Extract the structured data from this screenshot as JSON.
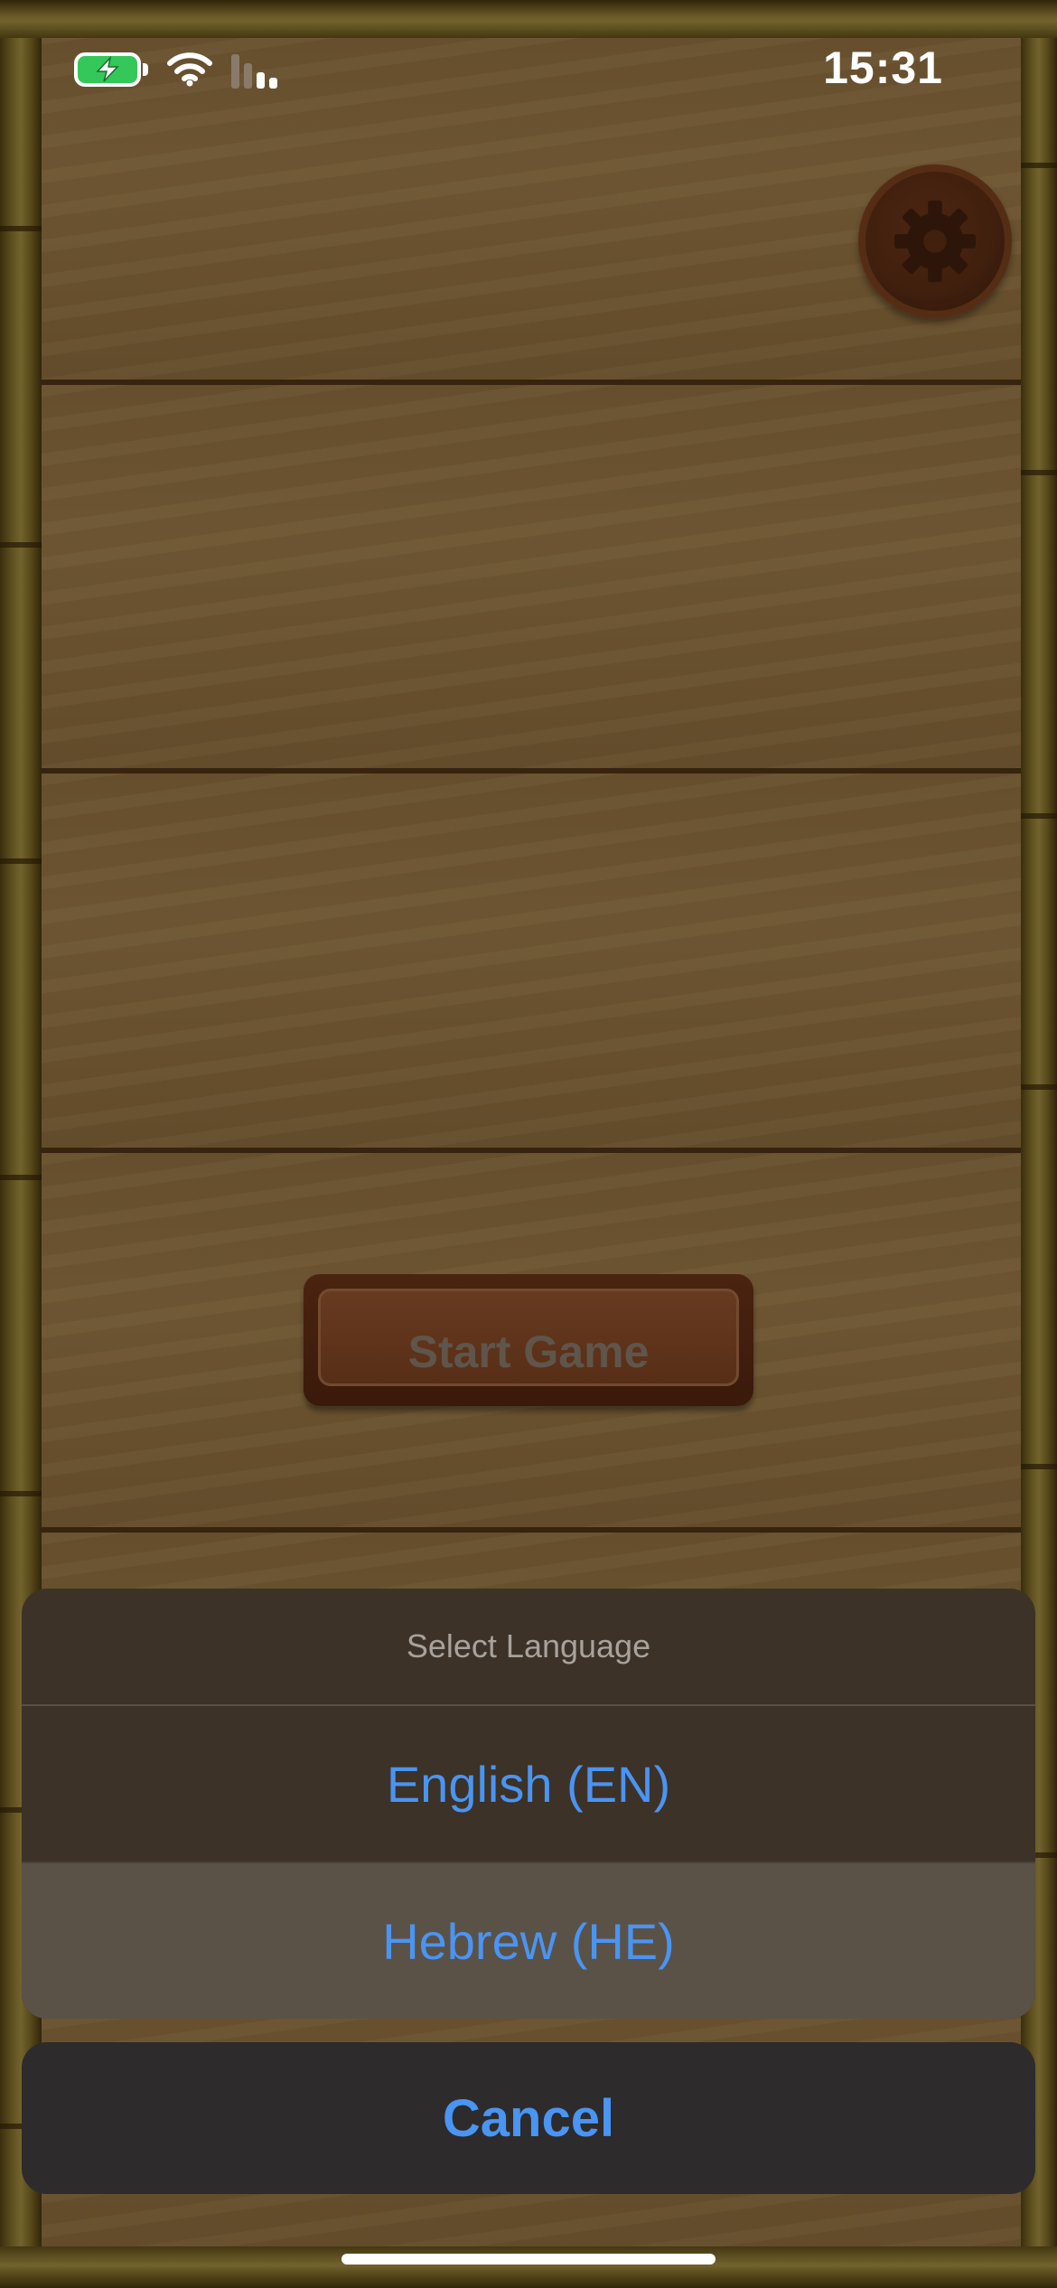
{
  "status_bar": {
    "time": "15:31",
    "battery_color": "#34c759"
  },
  "main": {
    "start_button_label": "Start Game",
    "settings_icon": "gear-icon"
  },
  "action_sheet": {
    "title": "Select Language",
    "options": [
      {
        "label": "English (EN)"
      },
      {
        "label": "Hebrew (HE)"
      }
    ],
    "cancel_label": "Cancel",
    "accent_color": "#4a94f2"
  }
}
